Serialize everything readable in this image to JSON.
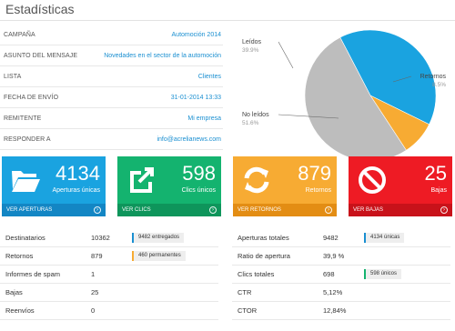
{
  "title": "Estadísticas",
  "info": [
    {
      "label": "CAMPAÑA",
      "value": "Automoción 2014"
    },
    {
      "label": "ASUNTO DEL MENSAJE",
      "value": "Novedades en el sector de la automoción"
    },
    {
      "label": "LISTA",
      "value": "Clientes"
    },
    {
      "label": "FECHA DE ENVÍO",
      "value": "31-01-2014 13:33"
    },
    {
      "label": "REMITENTE",
      "value": "Mi empresa"
    },
    {
      "label": "RESPONDER A",
      "value": "info@acrelianews.com"
    }
  ],
  "chart_data": {
    "type": "pie",
    "slices": [
      {
        "name": "Leídos",
        "label": "Leídos",
        "value": 39.9,
        "value_label": "39.9%",
        "color": "#1aa3e0"
      },
      {
        "name": "Retornos",
        "label": "Retornos",
        "value": 8.5,
        "value_label": "8.5%",
        "color": "#f7ab33"
      },
      {
        "name": "No leídos",
        "label": "No leídos",
        "value": 51.6,
        "value_label": "51.6%",
        "color": "#bdbdbd"
      }
    ]
  },
  "tiles": [
    {
      "num": "4134",
      "label": "Aperturas únicas",
      "link": "VER APERTURAS",
      "color": "#1aa3e0",
      "foot_color": "#1386c4",
      "icon": "folder-icon"
    },
    {
      "num": "598",
      "label": "Clics únicos",
      "link": "VER CLICS",
      "color": "#14b36f",
      "foot_color": "#0e955b",
      "icon": "external-link-icon"
    },
    {
      "num": "879",
      "label": "Retornos",
      "link": "VER RETORNOS",
      "color": "#f7ab33",
      "foot_color": "#e38d14",
      "icon": "refresh-icon"
    },
    {
      "num": "25",
      "label": "Bajas",
      "link": "VER BAJAS",
      "color": "#ee1b24",
      "foot_color": "#c8121a",
      "icon": "prohibited-icon"
    }
  ],
  "stats_left": [
    {
      "label": "Destinatarios",
      "value": "10362",
      "badge": "9482 entregados",
      "badge_color": "#1a8fd1"
    },
    {
      "label": "Retornos",
      "value": "879",
      "badge": "460 permanentes",
      "badge_color": "#f7ab33"
    },
    {
      "label": "Informes de spam",
      "value": "1",
      "badge": ""
    },
    {
      "label": "Bajas",
      "value": "25",
      "badge": ""
    },
    {
      "label": "Reenvíos",
      "value": "0",
      "badge": ""
    }
  ],
  "stats_right": [
    {
      "label": "Aperturas totales",
      "value": "9482",
      "badge": "4134 únicas",
      "badge_color": "#1a8fd1"
    },
    {
      "label": "Ratio de apertura",
      "value": "39,9 %",
      "badge": ""
    },
    {
      "label": "Clics totales",
      "value": "698",
      "badge": "598 únicos",
      "badge_color": "#14b36f"
    },
    {
      "label": "CTR",
      "value": "5,12%",
      "badge": ""
    },
    {
      "label": "CTOR",
      "value": "12,84%",
      "badge": ""
    }
  ]
}
